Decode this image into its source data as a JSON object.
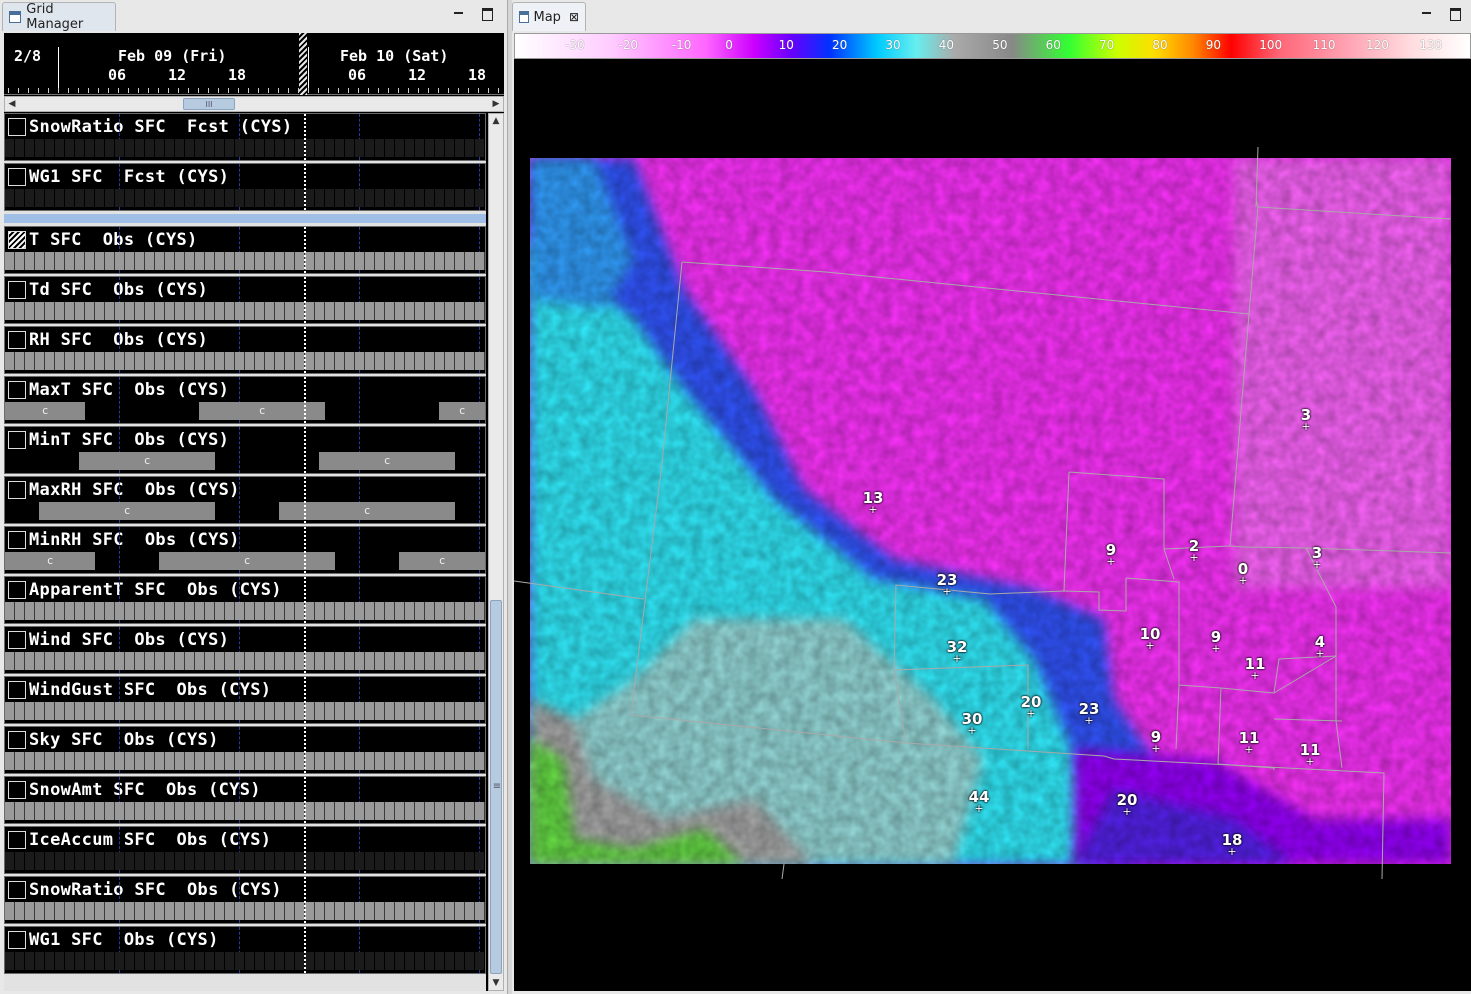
{
  "grid_manager": {
    "tab_title": "Grid Manager",
    "timebar": {
      "date_label": "2/8",
      "day1": "Feb 09 (Fri)",
      "day2": "Feb 10 (Sat)",
      "hours1": [
        "06",
        "12",
        "18"
      ],
      "hours2": [
        "06",
        "12",
        "18"
      ]
    },
    "hscroll_grip": "III",
    "vscroll_grip": "≡",
    "block_label": "c",
    "rows": [
      {
        "label": "SnowRatio SFC  Fcst (CYS)",
        "strip": "blank"
      },
      {
        "label": "WG1 SFC  Fcst (CYS)",
        "strip": "blank"
      },
      {
        "label": "T SFC  Obs (CYS)",
        "strip": "full",
        "selected": true
      },
      {
        "label": "Td SFC  Obs (CYS)",
        "strip": "full"
      },
      {
        "label": "RH SFC  Obs (CYS)",
        "strip": "full"
      },
      {
        "label": "MaxT SFC  Obs (CYS)",
        "strip": "blocks"
      },
      {
        "label": "MinT SFC  Obs (CYS)",
        "strip": "blocks"
      },
      {
        "label": "MaxRH SFC  Obs (CYS)",
        "strip": "blocks"
      },
      {
        "label": "MinRH SFC  Obs (CYS)",
        "strip": "blocks"
      },
      {
        "label": "ApparentT SFC  Obs (CYS)",
        "strip": "full"
      },
      {
        "label": "Wind SFC  Obs (CYS)",
        "strip": "full"
      },
      {
        "label": "WindGust SFC  Obs (CYS)",
        "strip": "full"
      },
      {
        "label": "Sky SFC  Obs (CYS)",
        "strip": "full"
      },
      {
        "label": "SnowAmt SFC  Obs (CYS)",
        "strip": "full"
      },
      {
        "label": "IceAccum SFC  Obs (CYS)",
        "strip": "blank"
      },
      {
        "label": "SnowRatio SFC  Obs (CYS)",
        "strip": "full"
      },
      {
        "label": "WG1 SFC  Obs (CYS)",
        "strip": "blank"
      }
    ]
  },
  "map": {
    "tab_title": "Map",
    "colorbar": {
      "labels": [
        "-30",
        "-20",
        "-10",
        "0",
        "10",
        "20",
        "30",
        "40",
        "50",
        "60",
        "70",
        "80",
        "90",
        "100",
        "110",
        "120",
        "130"
      ]
    },
    "stations": [
      {
        "value": "3"
      },
      {
        "value": "13"
      },
      {
        "value": "9"
      },
      {
        "value": "2"
      },
      {
        "value": "0"
      },
      {
        "value": "3"
      },
      {
        "value": "23"
      },
      {
        "value": "32"
      },
      {
        "value": "10"
      },
      {
        "value": "9"
      },
      {
        "value": "4"
      },
      {
        "value": "11"
      },
      {
        "value": "20"
      },
      {
        "value": "23"
      },
      {
        "value": "30"
      },
      {
        "value": "9"
      },
      {
        "value": "11"
      },
      {
        "value": "11"
      },
      {
        "value": "44"
      },
      {
        "value": "20"
      },
      {
        "value": "18"
      }
    ]
  }
}
